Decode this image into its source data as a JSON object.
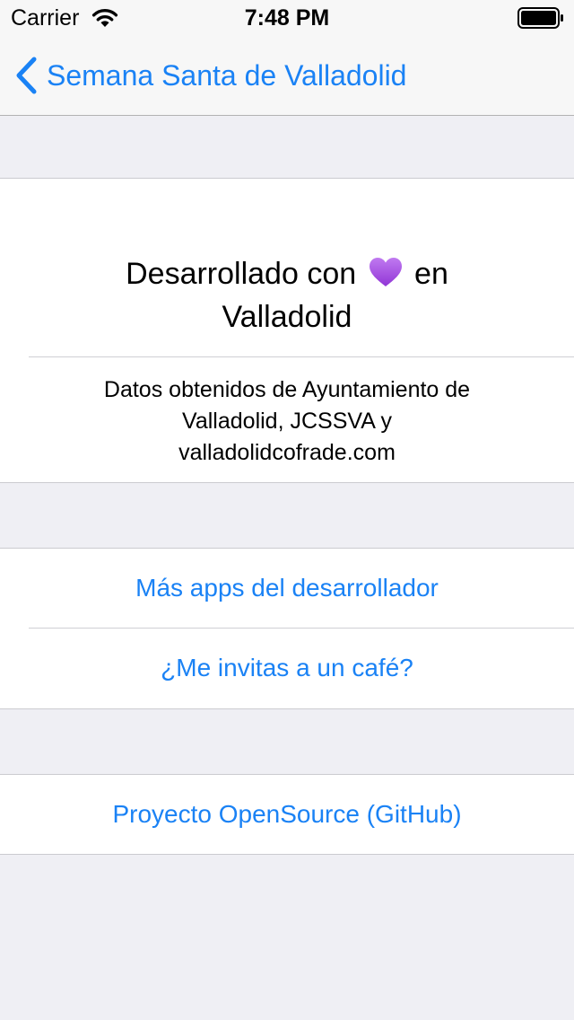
{
  "status_bar": {
    "carrier": "Carrier",
    "time": "7:48 PM"
  },
  "nav": {
    "back_label": "Semana Santa de Valladolid"
  },
  "about": {
    "headline_prefix": "Desarrollado con",
    "headline_suffix": "en",
    "headline_line2": "Valladolid",
    "heart_icon": "purple-heart-icon",
    "credits_line1": "Datos obtenidos de Ayuntamiento de",
    "credits_line2": "Valladolid, JCSSVA y",
    "credits_line3": "valladolidcofrade.com"
  },
  "links": {
    "more_apps": "Más apps del desarrollador",
    "coffee": "¿Me invitas a un café?",
    "opensource": "Proyecto OpenSource (GitHub)"
  },
  "colors": {
    "accent": "#1a82f5",
    "background": "#efeff4",
    "heart": "#a64de6"
  }
}
